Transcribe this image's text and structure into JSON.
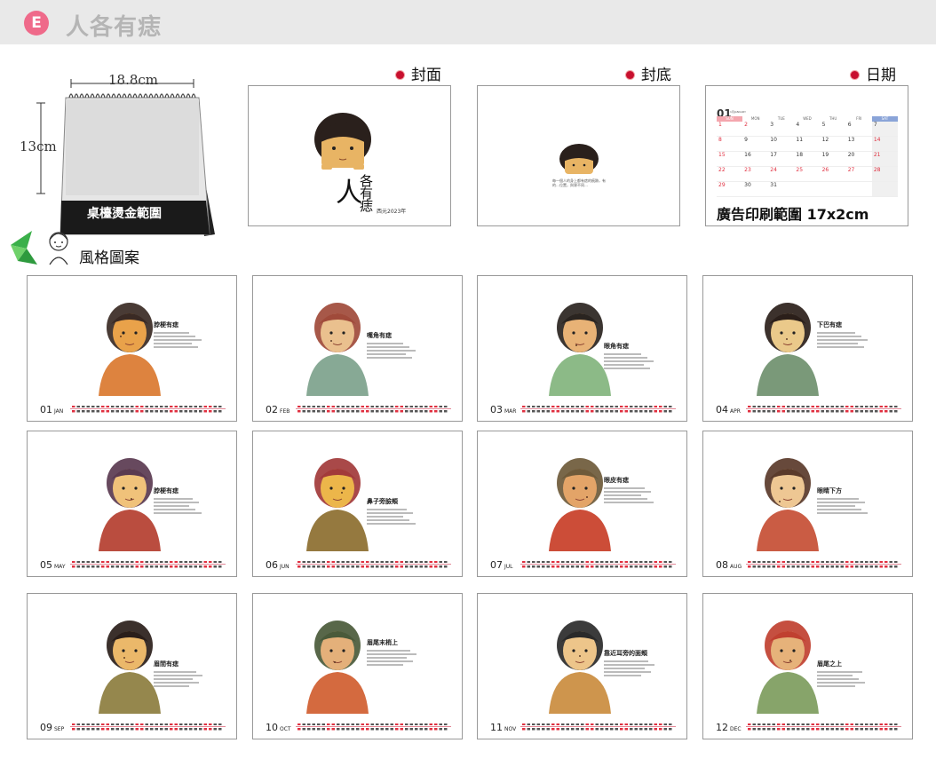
{
  "header": {
    "badge": "E",
    "title": "人各有痣"
  },
  "calendar_product": {
    "width_label": "18.8cm",
    "height_label": "13cm",
    "band_label": "桌檯燙金範圍"
  },
  "sections": {
    "cover": "封面",
    "back": "封底",
    "date": "日期",
    "style": "風格圖案"
  },
  "cover": {
    "title_main": "人",
    "title_rest": "各有痣",
    "subtitle": "西元2023年"
  },
  "back": {
    "text": "每一個人的身上都有痣的痕跡，有的…位置，與眾不同…"
  },
  "date_sample": {
    "month": "01",
    "subtitle": "1月JANUARY",
    "weekdays": [
      "SUN",
      "MON",
      "TUE",
      "WED",
      "THU",
      "FRI",
      "SAT"
    ],
    "rows": [
      [
        "1",
        "2",
        "3",
        "4",
        "5",
        "6",
        "7"
      ],
      [
        "8",
        "9",
        "10",
        "11",
        "12",
        "13",
        "14"
      ],
      [
        "15",
        "16",
        "17",
        "18",
        "19",
        "20",
        "21"
      ],
      [
        "22",
        "23",
        "24",
        "25",
        "26",
        "27",
        "28"
      ],
      [
        "29",
        "30",
        "31",
        "",
        "",
        "",
        ""
      ]
    ],
    "ad_label": "廣告印刷範圍 17x2cm"
  },
  "months": [
    {
      "num": "01",
      "abbr": "JAN",
      "title": "脖梗有痣",
      "skin": "#e9a24a",
      "hair": "#3a2a24",
      "cloth": "#d9752a"
    },
    {
      "num": "02",
      "abbr": "FEB",
      "title": "嘴角有痣",
      "skin": "#eac08e",
      "hair": "#a04a3a",
      "cloth": "#7aa089"
    },
    {
      "num": "03",
      "abbr": "MAR",
      "title": "眼角有痣",
      "skin": "#e8b276",
      "hair": "#2a2420",
      "cloth": "#7fb37a"
    },
    {
      "num": "04",
      "abbr": "APR",
      "title": "下巴有痣",
      "skin": "#eac98a",
      "hair": "#2b1f1a",
      "cloth": "#6b8e6a"
    },
    {
      "num": "05",
      "abbr": "MAY",
      "title": "脖梗有痣",
      "skin": "#f0c27a",
      "hair": "#5a3a50",
      "cloth": "#b23a2a"
    },
    {
      "num": "06",
      "abbr": "JUN",
      "title": "鼻子旁臉頰",
      "skin": "#ecb64a",
      "hair": "#a23a3a",
      "cloth": "#8a6a2a"
    },
    {
      "num": "07",
      "abbr": "JUL",
      "title": "眼皮有痣",
      "skin": "#e3a468",
      "hair": "#6e5a3a",
      "cloth": "#c73a22"
    },
    {
      "num": "08",
      "abbr": "AUG",
      "title": "眼睛下方",
      "skin": "#eec793",
      "hair": "#5a3a2a",
      "cloth": "#c44a30"
    },
    {
      "num": "09",
      "abbr": "SEP",
      "title": "眉間有痣",
      "skin": "#ebb86a",
      "hair": "#2a1e1a",
      "cloth": "#8a7a3a"
    },
    {
      "num": "10",
      "abbr": "OCT",
      "title": "眉尾末梢上",
      "skin": "#e4b07a",
      "hair": "#4a5a3a",
      "cloth": "#cf5a2a"
    },
    {
      "num": "11",
      "abbr": "NOV",
      "title": "靠近耳旁的面頰",
      "skin": "#edc58a",
      "hair": "#2a2a2a",
      "cloth": "#c98a3a"
    },
    {
      "num": "12",
      "abbr": "DEC",
      "title": "眉尾之上",
      "skin": "#e6b27a",
      "hair": "#c04030",
      "cloth": "#7a9a5a"
    }
  ]
}
